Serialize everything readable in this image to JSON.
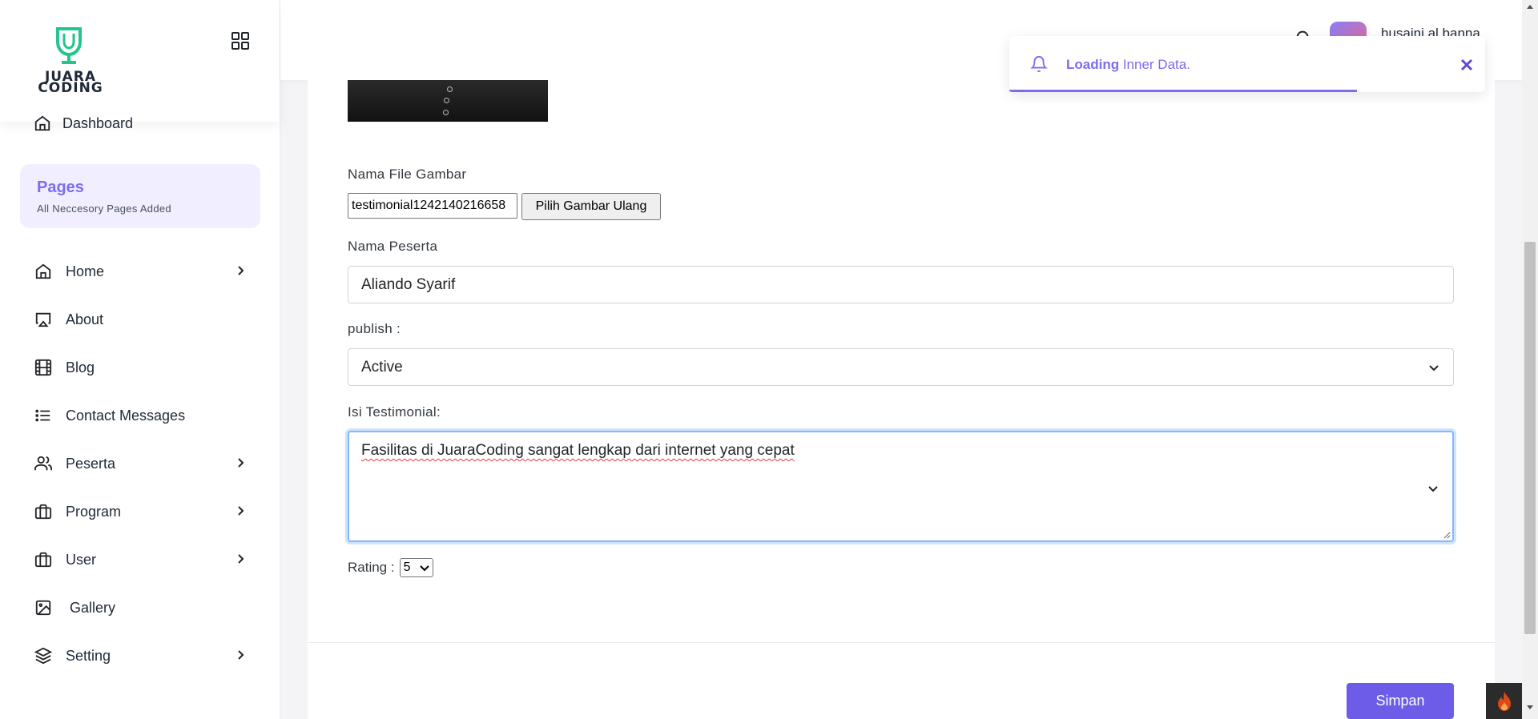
{
  "app": {
    "logo_text_line1": "JUARA",
    "logo_text_line2": "CODING",
    "brand_color": "#22c58b",
    "accent_color": "#6c5ce7"
  },
  "sidebar": {
    "dashboard_label": "Dashboard",
    "pages_title": "Pages",
    "pages_subtitle": "All Neccesory Pages Added",
    "items": [
      {
        "label": "Home",
        "icon": "home-icon",
        "has_submenu": true
      },
      {
        "label": "About",
        "icon": "airplay-icon",
        "has_submenu": false
      },
      {
        "label": "Blog",
        "icon": "film-icon",
        "has_submenu": false
      },
      {
        "label": "Contact Messages",
        "icon": "list-icon",
        "has_submenu": false
      },
      {
        "label": "Peserta",
        "icon": "users-icon",
        "has_submenu": true
      },
      {
        "label": "Program",
        "icon": "briefcase-icon",
        "has_submenu": true
      },
      {
        "label": "User",
        "icon": "briefcase-icon",
        "has_submenu": true
      },
      {
        "label": "Gallery",
        "icon": "image-icon",
        "has_submenu": false
      },
      {
        "label": "Setting",
        "icon": "layers-icon",
        "has_submenu": true
      }
    ]
  },
  "header": {
    "username": "husaini al banna"
  },
  "toast": {
    "bold_text": "Loading",
    "text": " Inner Data.",
    "progress": 0.73
  },
  "form": {
    "file_label": "Nama File Gambar",
    "file_value": "testimonial1242140216658",
    "pick_button": "Pilih Gambar Ulang",
    "name_label": "Nama Peserta",
    "name_value": "Aliando Syarif",
    "publish_label": "publish :",
    "publish_value": "Active",
    "testimonial_label": "Isi Testimonial:",
    "testimonial_value": "Fasilitas di JuaraCoding sangat lengkap dari internet yang cepat",
    "rating_label": "Rating :",
    "rating_value": "5",
    "save_button": "Simpan"
  }
}
